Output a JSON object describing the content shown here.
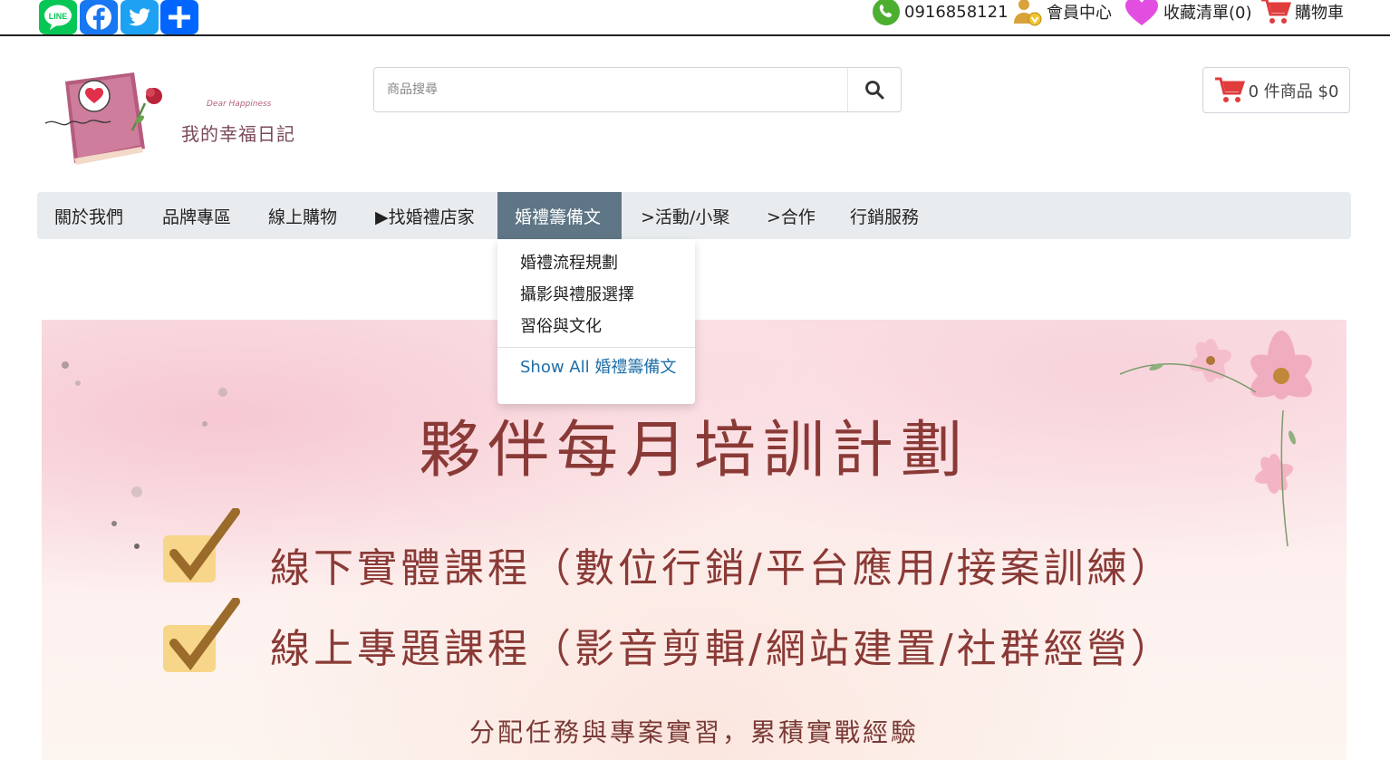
{
  "topbar": {
    "share_icons": [
      "line-icon",
      "facebook-icon",
      "twitter-icon",
      "share-plus-icon"
    ],
    "line_label": "LINE",
    "phone": "0916858121",
    "member_center": "會員中心",
    "wishlist": "收藏清單(0)",
    "cart": "購物車"
  },
  "logo": {
    "brand_en": "Dear Happiness",
    "brand_cn": "我的幸福日記"
  },
  "search": {
    "placeholder": "商品搜尋"
  },
  "mini_cart": {
    "label": "0 件商品 $0"
  },
  "nav": {
    "items": [
      {
        "label": "關於我們"
      },
      {
        "label": "品牌專區"
      },
      {
        "label": "線上購物"
      },
      {
        "label": "▶找婚禮店家"
      },
      {
        "label": "婚禮籌備文"
      },
      {
        "label": ">活動/小聚"
      },
      {
        "label": ">合作"
      },
      {
        "label": "行銷服務"
      }
    ]
  },
  "dropdown": {
    "items": [
      "婚禮流程規劃",
      "攝影與禮服選擇",
      "習俗與文化"
    ],
    "show_all": "Show All 婚禮籌備文"
  },
  "banner": {
    "title": "夥伴每月培訓計劃",
    "line1": "線下實體課程（數位行銷/平台應用/接案訓練）",
    "line2": "線上專題課程（影音剪輯/網站建置/社群經營）",
    "subtitle": "分配任務與專案實習，累積實戰經驗"
  },
  "colors": {
    "line_green": "#06c755",
    "facebook_blue": "#1877f2",
    "twitter_blue": "#1da1f2",
    "share_blue": "#0166ff",
    "nav_active": "#5f7686",
    "nav_bg": "#e9ecef",
    "cart_red": "#e03c3c",
    "banner_text": "#8a3a36",
    "link_blue": "#1f6fa8"
  }
}
